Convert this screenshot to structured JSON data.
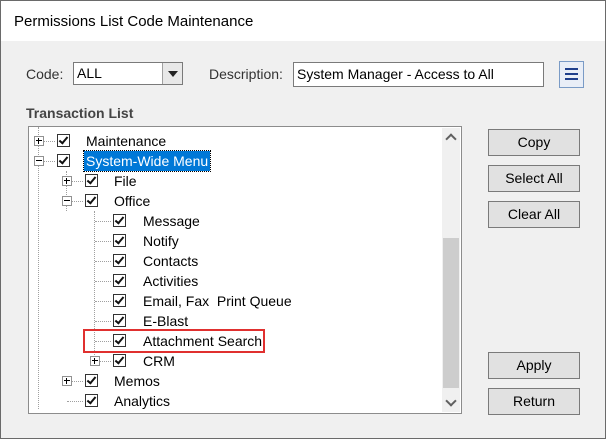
{
  "window": {
    "title": "Permissions List Code Maintenance"
  },
  "code": {
    "label": "Code:",
    "value": "ALL"
  },
  "description": {
    "label": "Description:",
    "value": "System Manager - Access to All"
  },
  "section_title": "Transaction List",
  "tree": {
    "items": [
      {
        "label": "Maintenance"
      },
      {
        "label": "System-Wide Menu"
      },
      {
        "label": "File"
      },
      {
        "label": "Office"
      },
      {
        "label": "Message"
      },
      {
        "label": "Notify"
      },
      {
        "label": "Contacts"
      },
      {
        "label": "Activities"
      },
      {
        "label": "Email, Fax  Print Queue"
      },
      {
        "label": "E-Blast"
      },
      {
        "label": "Attachment Search"
      },
      {
        "label": "CRM"
      },
      {
        "label": "Memos"
      },
      {
        "label": "Analytics"
      }
    ]
  },
  "buttons": {
    "copy": "Copy",
    "select_all": "Select All",
    "clear_all": "Clear All",
    "apply": "Apply",
    "return": "Return"
  }
}
